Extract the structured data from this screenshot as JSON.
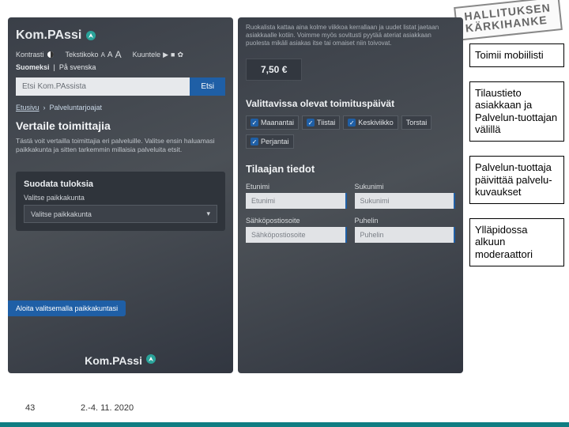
{
  "stamp": {
    "line1": "HALLITUKSEN",
    "line2": "KÄRKIHANKE"
  },
  "annotations": {
    "a1": "Toimii mobiilisti",
    "a2": "Tilaustieto asiakkaan ja Palvelun-tuottajan välillä",
    "a3": "Palvelun-tuottaja päivittää palvelu-kuvaukset",
    "a4": "Ylläpidossa alkuun moderaattori"
  },
  "left": {
    "brand": "Kom.PAssi",
    "toolbar": {
      "kontrasti": "Kontrasti",
      "teksti": "Tekstikoko",
      "kuuntele": "Kuuntele"
    },
    "lang": {
      "fi": "Suomeksi",
      "sv": "På svenska"
    },
    "search": {
      "placeholder": "Etsi Kom.PAssista",
      "button": "Etsi"
    },
    "breadcrumb": {
      "home": "Etusivu",
      "current": "Palveluntarjoajat"
    },
    "h1": "Vertaile toimittajia",
    "para": "Tästä voit vertailla toimittajia eri palveluille. Valitse ensin haluamasi paikkakunta ja sitten tarkemmin millaisia palveluita etsit.",
    "filter": {
      "heading": "Suodata tuloksia",
      "label": "Valitse paikkakunta",
      "value": "Valitse paikkakunta"
    },
    "toast": "Aloita valitsemalla paikkakuntasi"
  },
  "right": {
    "blur": "Ruokalista kattaa aina kolme viikkoa kerrallaan ja uudet listat jaetaan asiakkaalle kotiin. Voimme myös sovitusti pyytää ateriat asiakkaan puolesta mikäli asiakas itse tai omaiset niin toivovat.",
    "price": "7,50 €",
    "daysHeading": "Valittavissa olevat toimituspäivät",
    "days": {
      "mon": "Maanantai",
      "tue": "Tiistai",
      "wed": "Keskiviikko",
      "thu": "Torstai",
      "fri": "Perjantai"
    },
    "orderHeading": "Tilaajan tiedot",
    "fields": {
      "fn_label": "Etunimi",
      "fn_ph": "Etunimi",
      "ln_label": "Sukunimi",
      "ln_ph": "Sukunimi",
      "email_label": "Sähköpostiosoite",
      "email_ph": "Sähköpostiosoite",
      "phone_label": "Puhelin",
      "phone_ph": "Puhelin"
    }
  },
  "footer": {
    "page": "43",
    "date": "2.-4. 11. 2020"
  }
}
